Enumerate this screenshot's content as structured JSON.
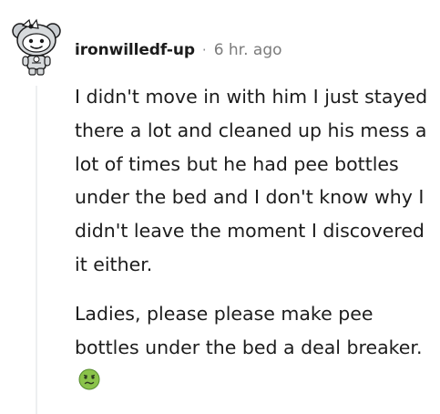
{
  "comment": {
    "username": "ironwilledf-up",
    "separator": "·",
    "timestamp": "6 hr. ago",
    "paragraphs": [
      "I didn't move in with him I just stayed there a lot and cleaned up his mess a lot of times but he had pee bottles under the bed and I don't know why I didn't leave the moment I discovered it either.",
      "Ladies, please please make pee bottles under the bed a deal breaker."
    ],
    "emoji": "nauseated-face-emoji",
    "avatar": "snoo-avatar-with-bow"
  },
  "colors": {
    "username": "#1c1c1c",
    "timestamp": "#7c7c7c",
    "thread_line": "#edeff1",
    "body_text": "#1c1c1c"
  }
}
